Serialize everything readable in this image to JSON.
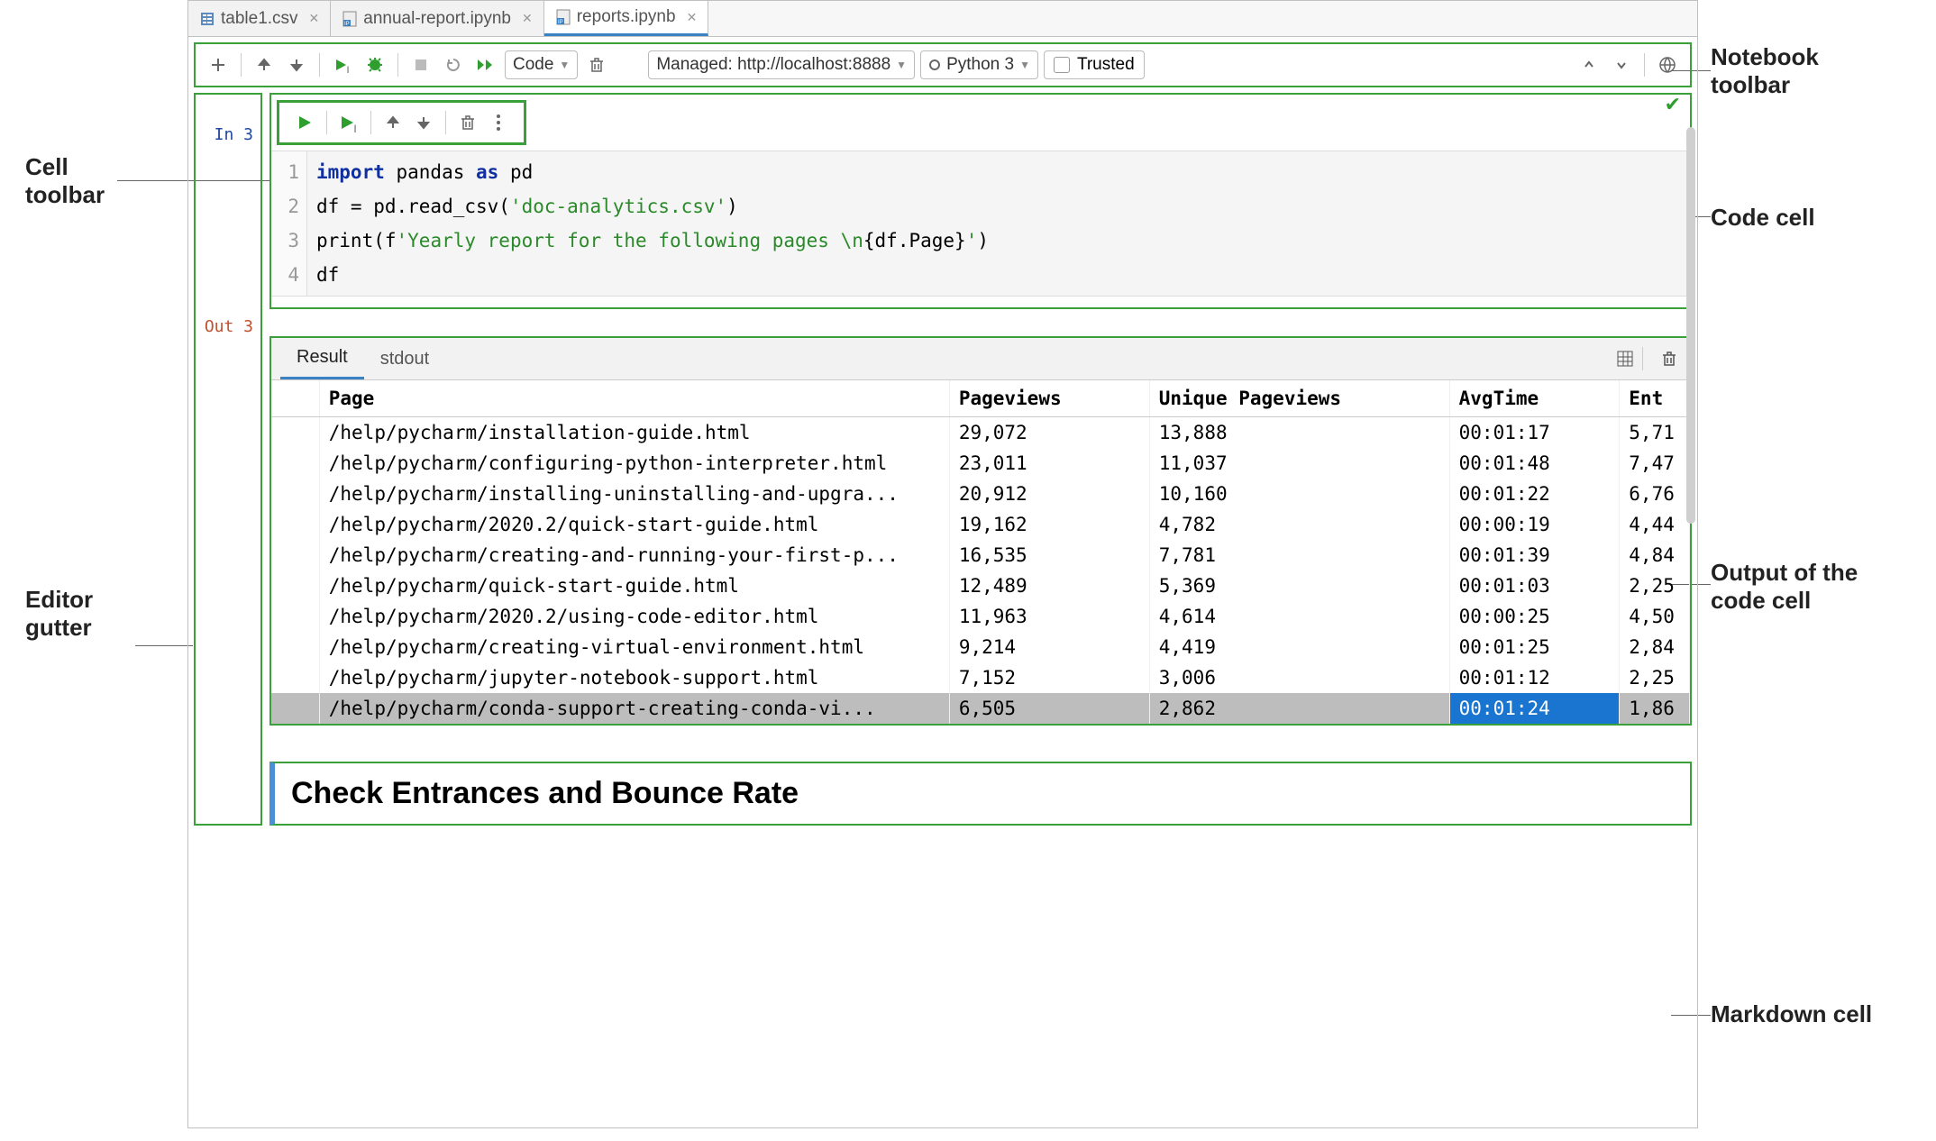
{
  "tabs": [
    {
      "label": "table1.csv",
      "icon": "csv"
    },
    {
      "label": "annual-report.ipynb",
      "icon": "ipynb"
    },
    {
      "label": "reports.ipynb",
      "icon": "ipynb",
      "active": true
    }
  ],
  "nb_toolbar": {
    "cell_type": "Code",
    "managed": "Managed: http://localhost:8888",
    "kernel": "Python 3",
    "trusted": "Trusted"
  },
  "cell": {
    "in_label": "In 3",
    "out_label": "Out 3",
    "code_lines": [
      "1",
      "2",
      "3",
      "4"
    ],
    "code_tokens": [
      [
        {
          "t": "import",
          "c": "kw"
        },
        {
          "t": " pandas ",
          "c": ""
        },
        {
          "t": "as",
          "c": "kw"
        },
        {
          "t": " pd",
          "c": ""
        }
      ],
      [
        {
          "t": "df = pd.read_csv(",
          "c": ""
        },
        {
          "t": "'doc-analytics.csv'",
          "c": "str"
        },
        {
          "t": ")",
          "c": ""
        }
      ],
      [
        {
          "t": "print(f",
          "c": ""
        },
        {
          "t": "'Yearly report for the following pages \\n",
          "c": "str"
        },
        {
          "t": "{df.Page}",
          "c": ""
        },
        {
          "t": "'",
          "c": "str"
        },
        {
          "t": ")",
          "c": ""
        }
      ],
      [
        {
          "t": "df",
          "c": ""
        }
      ]
    ]
  },
  "output": {
    "tabs": [
      "Result",
      "stdout"
    ],
    "active_tab": 0,
    "columns": [
      "Page",
      "Pageviews",
      "Unique Pageviews",
      "AvgTime",
      "Ent"
    ],
    "rows": [
      {
        "page": "/help/pycharm/installation-guide.html",
        "pv": "29,072",
        "upv": "13,888",
        "avg": "00:01:17",
        "ent": "5,71"
      },
      {
        "page": "/help/pycharm/configuring-python-interpreter.html",
        "pv": "23,011",
        "upv": "11,037",
        "avg": "00:01:48",
        "ent": "7,47"
      },
      {
        "page": "/help/pycharm/installing-uninstalling-and-upgra...",
        "pv": "20,912",
        "upv": "10,160",
        "avg": "00:01:22",
        "ent": "6,76"
      },
      {
        "page": "/help/pycharm/2020.2/quick-start-guide.html",
        "pv": "19,162",
        "upv": "4,782",
        "avg": "00:00:19",
        "ent": "4,44"
      },
      {
        "page": "/help/pycharm/creating-and-running-your-first-p...",
        "pv": "16,535",
        "upv": "7,781",
        "avg": "00:01:39",
        "ent": "4,84"
      },
      {
        "page": "/help/pycharm/quick-start-guide.html",
        "pv": "12,489",
        "upv": "5,369",
        "avg": "00:01:03",
        "ent": "2,25"
      },
      {
        "page": "/help/pycharm/2020.2/using-code-editor.html",
        "pv": "11,963",
        "upv": "4,614",
        "avg": "00:00:25",
        "ent": "4,50"
      },
      {
        "page": "/help/pycharm/creating-virtual-environment.html",
        "pv": "9,214",
        "upv": "4,419",
        "avg": "00:01:25",
        "ent": "2,84"
      },
      {
        "page": "/help/pycharm/jupyter-notebook-support.html",
        "pv": "7,152",
        "upv": "3,006",
        "avg": "00:01:12",
        "ent": "2,25"
      },
      {
        "page": "/help/pycharm/conda-support-creating-conda-vi...",
        "pv": "6,505",
        "upv": "2,862",
        "avg": "00:01:24",
        "ent": "1,86",
        "highlight": true
      }
    ]
  },
  "markdown": {
    "heading": "Check Entrances and Bounce Rate"
  },
  "annotations": {
    "cell_toolbar": "Cell\ntoolbar",
    "editor_gutter": "Editor\ngutter",
    "notebook_toolbar": "Notebook\ntoolbar",
    "code_cell": "Code cell",
    "output": "Output of the\ncode cell",
    "markdown_cell": "Markdown cell"
  }
}
